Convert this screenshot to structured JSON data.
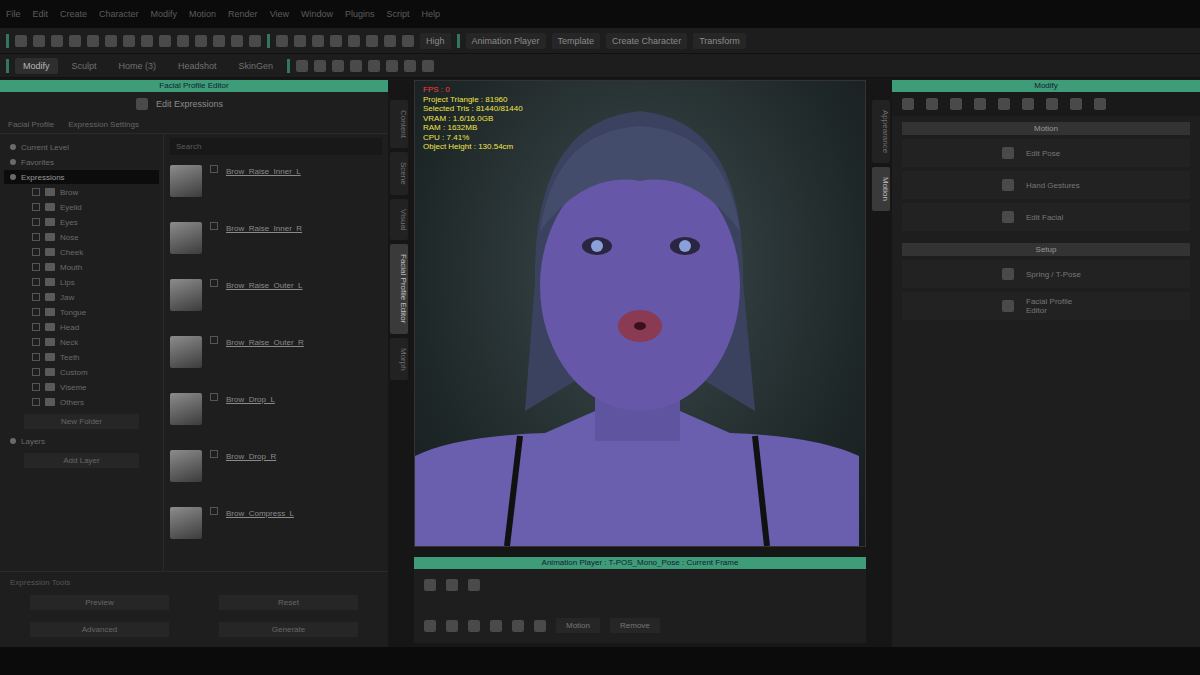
{
  "menu": [
    "File",
    "Edit",
    "Create",
    "Character",
    "Modify",
    "Motion",
    "Render",
    "View",
    "Window",
    "Plugins",
    "Script",
    "Help"
  ],
  "toolbar": {
    "quality": "High",
    "buttons": [
      "Animation Player",
      "Template",
      "Create Character",
      "Transform"
    ]
  },
  "mode_tabs": [
    {
      "label": "Modify",
      "selected": true
    },
    {
      "label": "Sculpt",
      "selected": false
    },
    {
      "label": "Home (3)",
      "selected": false
    },
    {
      "label": "Headshot",
      "selected": false
    },
    {
      "label": "SkinGen",
      "selected": false
    }
  ],
  "left_panel": {
    "title": "Facial Profile Editor",
    "header": "Edit Expressions",
    "sub_tabs": [
      "Facial Profile",
      "Expression Settings"
    ],
    "search": "Search",
    "tree": [
      {
        "label": "Current Level",
        "selected": false,
        "top": true
      },
      {
        "label": "Favorites",
        "selected": false,
        "top": true
      },
      {
        "label": "Expressions",
        "selected": true,
        "top": true
      },
      {
        "label": "Brow",
        "selected": false,
        "top": false
      },
      {
        "label": "Eyelid",
        "selected": false,
        "top": false
      },
      {
        "label": "Eyes",
        "selected": false,
        "top": false
      },
      {
        "label": "Nose",
        "selected": false,
        "top": false
      },
      {
        "label": "Cheek",
        "selected": false,
        "top": false
      },
      {
        "label": "Mouth",
        "selected": false,
        "top": false
      },
      {
        "label": "Lips",
        "selected": false,
        "top": false
      },
      {
        "label": "Jaw",
        "selected": false,
        "top": false
      },
      {
        "label": "Tongue",
        "selected": false,
        "top": false
      },
      {
        "label": "Head",
        "selected": false,
        "top": false
      },
      {
        "label": "Neck",
        "selected": false,
        "top": false
      },
      {
        "label": "Teeth",
        "selected": false,
        "top": false
      },
      {
        "label": "Custom",
        "selected": false,
        "top": false
      },
      {
        "label": "Viseme",
        "selected": false,
        "top": false
      },
      {
        "label": "Others",
        "selected": false,
        "top": false
      }
    ],
    "tree_footer": "New Folder",
    "layers": "Layers",
    "layers_button": "Add Layer",
    "expressions": [
      "Brow_Raise_Inner_L",
      "Brow_Raise_Inner_R",
      "Brow_Raise_Outer_L",
      "Brow_Raise_Outer_R",
      "Brow_Drop_L",
      "Brow_Drop_R",
      "Brow_Compress_L"
    ],
    "tools_title": "Expression Tools",
    "buttons": [
      "Preview",
      "Reset",
      "Advanced",
      "Generate"
    ]
  },
  "left_side_tabs": [
    {
      "label": "Content",
      "selected": false
    },
    {
      "label": "Scene",
      "selected": false
    },
    {
      "label": "Visual",
      "selected": false
    },
    {
      "label": "Facial Profile Editor",
      "selected": true
    },
    {
      "label": "Morph",
      "selected": false
    }
  ],
  "viewport": {
    "stats": [
      {
        "text": "FPS : 0",
        "color": "#ff3b3b"
      },
      {
        "text": "Project Triangle : 81960",
        "color": "#f0e44a"
      },
      {
        "text": "Selected Tris : 81440/81440",
        "color": "#f0e44a"
      },
      {
        "text": "VRAM : 1.6/16.0GB",
        "color": "#f0e44a"
      },
      {
        "text": "RAM : 1632MB",
        "color": "#f0e44a"
      },
      {
        "text": "CPU : 7.41%",
        "color": "#f0e44a"
      },
      {
        "text": "Object Height : 130.54cm",
        "color": "#f0e44a"
      }
    ]
  },
  "animation_player": {
    "title": "Animation Player : T-POS_Mono_Pose : Current Frame",
    "buttons": [
      "Motion",
      "Remove"
    ]
  },
  "right_side_tabs": [
    {
      "label": "Appearance",
      "selected": false
    },
    {
      "label": "Motion",
      "selected": true
    }
  ],
  "right_panel": {
    "title": "Modify",
    "sections": [
      {
        "title": "Motion",
        "items": [
          "Edit Pose",
          "Hand Gestures",
          "Edit Facial"
        ]
      },
      {
        "title": "Setup",
        "items": [
          "Spring / T-Pose",
          "Facial Profile Editor"
        ]
      }
    ]
  }
}
